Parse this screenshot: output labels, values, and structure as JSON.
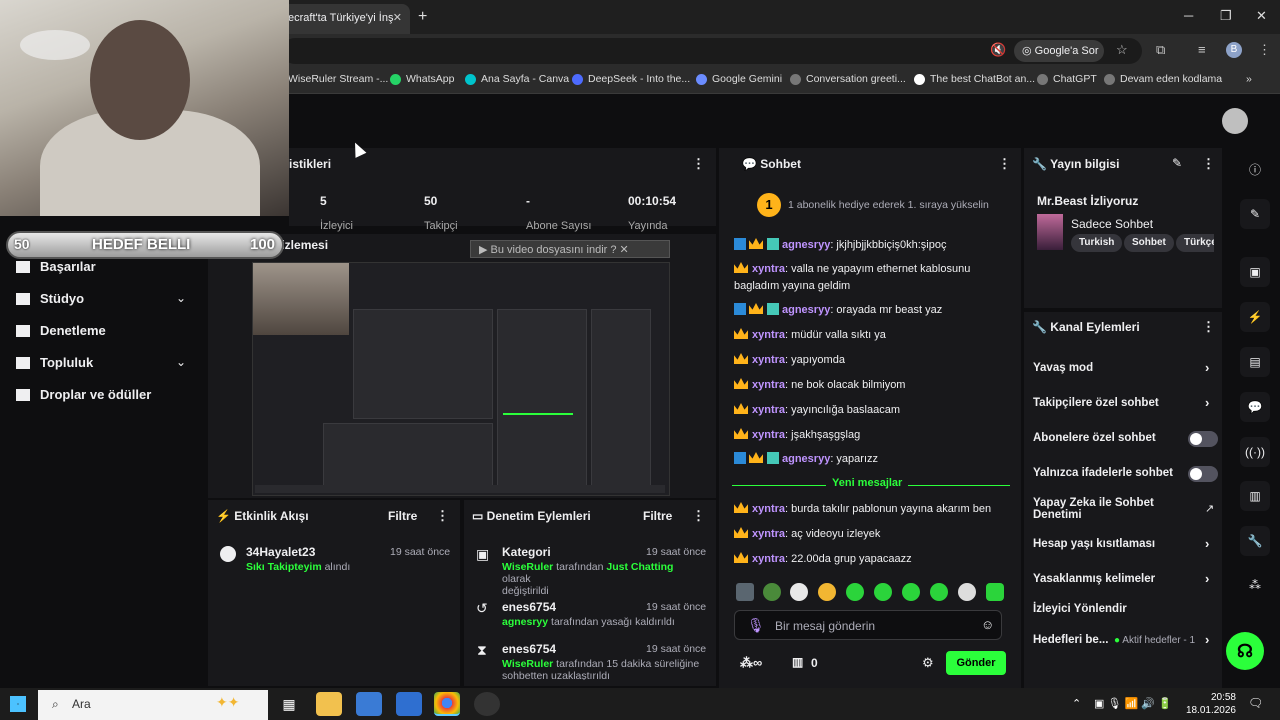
{
  "browser": {
    "tab_title": "ecraft'ta Türkiye'yi İnş",
    "google_pill": "Google'a Sor",
    "profile_initial": "B",
    "bookmarks": [
      "WiseRuler Stream -...",
      "WhatsApp",
      "Ana Sayfa - Canva",
      "DeepSeek - Into the...",
      "Google Gemini",
      "Conversation greeti...",
      "The best ChatBot an...",
      "ChatGPT",
      "Devam eden kodlama"
    ]
  },
  "overlay": {
    "goal_start": "50",
    "goal_label": "HEDEF BELLI",
    "goal_end": "100"
  },
  "stats": {
    "title": "istikleri",
    "items": [
      {
        "value": "5",
        "label": "İzleyici"
      },
      {
        "value": "50",
        "label": "Takipçi"
      },
      {
        "value": "-",
        "label": "Abone Sayısı"
      },
      {
        "value": "00:10:54",
        "label": "Yayında"
      }
    ]
  },
  "preview": {
    "title": "Yayın önizlemesi",
    "download_label": "Bu video dosyasını indir"
  },
  "nav": [
    {
      "label": "Başarılar"
    },
    {
      "label": "Stüdyo"
    },
    {
      "label": "Denetleme"
    },
    {
      "label": "Topluluk"
    },
    {
      "label": "Droplar ve ödüller"
    }
  ],
  "activity": {
    "title": "Etkinlik Akışı",
    "filter": "Filtre",
    "events": [
      {
        "name": "34Hayalet23",
        "time": "19 saat önce",
        "highlight": "Sıkı Takipteyim",
        "rest": " alındı"
      }
    ]
  },
  "moderation": {
    "title": "Denetim Eylemleri",
    "filter": "Filtre",
    "events": [
      {
        "name": "Kategori",
        "time": "19 saat önce",
        "line1a": "WiseRuler",
        "line1b": " tarafından ",
        "line1c": "Just Chatting",
        "line1d": " olarak",
        "line2": "değiştirildi"
      },
      {
        "name": "enes6754",
        "time": "19 saat önce",
        "line1a": "agnesryy",
        "line1b": " tarafından yasağı kaldırıldı"
      },
      {
        "name": "enes6754",
        "time": "19 saat önce",
        "line1a": "WiseRuler",
        "line1b": " tarafından 15 dakika süreliğine",
        "line2": "sohbetten uzaklaştırıldı"
      }
    ]
  },
  "chat": {
    "title": "Sohbet",
    "gift_rank": "1",
    "gift_text": "1 abonelik hediye ederek 1. sıraya yükselin",
    "messages": [
      {
        "user": "agnesryy",
        "text": ": jkjhjbjjkbbiçiş0kh:şipoç"
      },
      {
        "user": "xyntra",
        "text": ": valla ne yapayım ethernet kablosunu bagladım yayına geldim"
      },
      {
        "user": "agnesryy",
        "text": ": orayada mr beast yaz"
      },
      {
        "user": "xyntra",
        "text": ": müdür valla sıktı ya"
      },
      {
        "user": "xyntra",
        "text": ": yapıyomda"
      },
      {
        "user": "xyntra",
        "text": ": ne bok olacak bilmiyom"
      },
      {
        "user": "xyntra",
        "text": ": yayıncılığa baslaacam"
      },
      {
        "user": "xyntra",
        "text": ": jşakhşaşgşlag"
      },
      {
        "user": "agnesryy",
        "text": ": yaparızz"
      },
      {
        "user": "xyntra",
        "text": ": burda takılır pablonun yayına akarım ben"
      },
      {
        "user": "xyntra",
        "text": ": aç videoyu izleyek"
      },
      {
        "user": "xyntra",
        "text": ": 22.00da grup yapacaazz"
      }
    ],
    "new_messages": "Yeni mesajlar",
    "input_placeholder": "Bir mesaj gönderin",
    "points": "0",
    "send": "Gönder"
  },
  "stream_info": {
    "title": "Yayın bilgisi",
    "stream_title": "Mr.Beast İzliyoruz",
    "category": "Sadece Sohbet",
    "tags": [
      "Turkish",
      "Sohbet",
      "Türkçe"
    ]
  },
  "channel_actions": {
    "title": "Kanal Eylemleri",
    "items": [
      {
        "label": "Yavaş mod"
      },
      {
        "label": "Takipçilere özel sohbet"
      },
      {
        "label": "Abonelere özel sohbet"
      },
      {
        "label": "Yalnızca ifadelerle sohbet"
      },
      {
        "label": "Yapay Zeka ile Sohbet"
      },
      {
        "label": "Denetimi"
      },
      {
        "label": "Hesap yaşı kısıtlaması"
      },
      {
        "label": "Yasaklanmış kelimeler"
      },
      {
        "label": "İzleyici Yönlendir"
      },
      {
        "label": "Hedefleri be..."
      },
      {
        "label": "Aktif hedefler - 1"
      }
    ]
  },
  "taskbar": {
    "search": "Ara",
    "time": "20:58",
    "date": "18.01.2026"
  }
}
